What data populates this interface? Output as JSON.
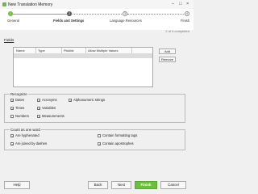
{
  "window": {
    "title": "New Translation Memory",
    "minimize": "–",
    "maximize": "□",
    "close": "×"
  },
  "wizard": {
    "steps": [
      {
        "number": "✓",
        "label": "General"
      },
      {
        "number": "2",
        "label": "Fields and Settings"
      },
      {
        "number": "3",
        "label": "Language Resources"
      },
      {
        "number": "4",
        "label": "Finish"
      }
    ],
    "progress": "2 of 4 completed"
  },
  "fields": {
    "label": "Fields",
    "columns": [
      "Name",
      "Type",
      "Picklist",
      "Allow Multiple Values"
    ],
    "add_button": "Add",
    "remove_button": "Remove"
  },
  "recognize": {
    "title": "Recognize",
    "items": {
      "dates": {
        "label": "Dates",
        "checked": true
      },
      "times": {
        "label": "Times",
        "checked": true
      },
      "numbers": {
        "label": "Numbers",
        "checked": false
      },
      "acronyms": {
        "label": "Acronyms",
        "checked": true
      },
      "variables": {
        "label": "Variables",
        "checked": true
      },
      "measurements": {
        "label": "Measurements",
        "checked": true
      },
      "alphanumeric": {
        "label": "Alphanumeric strings",
        "checked": true
      }
    }
  },
  "count_as_one_word": {
    "title": "Count as one word",
    "items": {
      "hyphenated": {
        "label": "Are hyphenated",
        "checked": true
      },
      "dashes": {
        "label": "Are joined by dashes",
        "checked": true
      },
      "formatting": {
        "label": "Contain formatting tags",
        "checked": false
      },
      "apostrophes": {
        "label": "Contain apostrophes",
        "checked": true
      }
    }
  },
  "footer": {
    "help": "Help",
    "back": "Back",
    "next": "Next",
    "finish": "Finish",
    "cancel": "Cancel"
  },
  "colors": {
    "accent": "#6bbf3a",
    "step_active": "#555555"
  }
}
